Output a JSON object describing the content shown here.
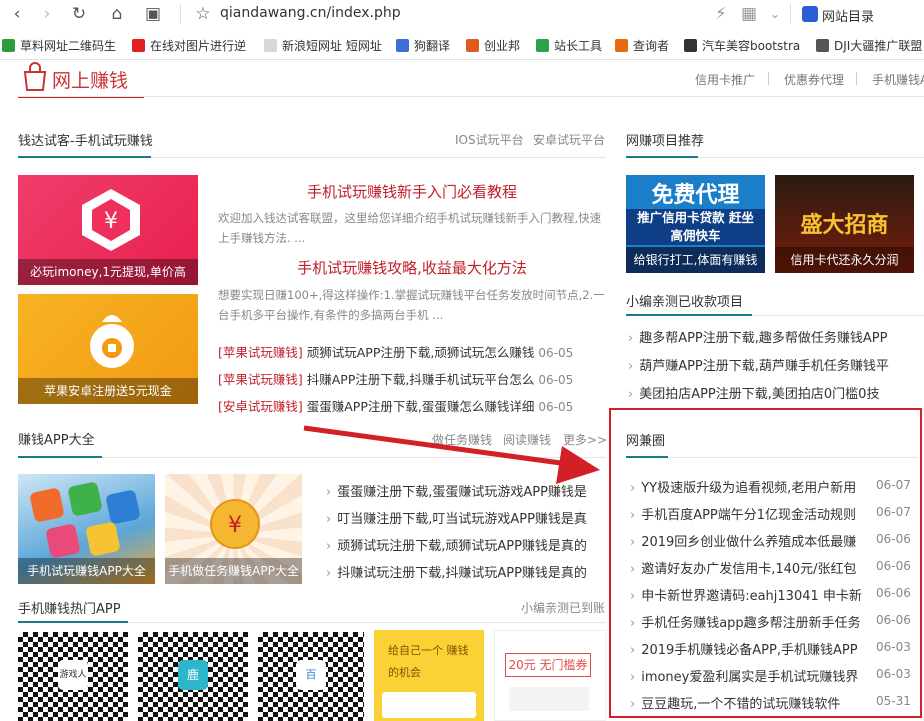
{
  "browser": {
    "url": "qiandawang.cn/index.php",
    "nav_directory": "网站目录",
    "bookmarks": [
      {
        "label": "草料网址二维码生",
        "color": "#2e9a3a"
      },
      {
        "label": "在线对图片进行逆",
        "color": "#e02020"
      },
      {
        "label": "新浪短网址 短网址",
        "color": "#d8d8d8"
      },
      {
        "label": "狗翻译",
        "color": "#3b6fd6"
      },
      {
        "label": "创业邦",
        "color": "#e05a1c"
      },
      {
        "label": "站长工具",
        "color": "#2aa14a"
      },
      {
        "label": "查询者",
        "color": "#e86a10"
      },
      {
        "label": "汽车美容bootstra",
        "color": "#333333"
      },
      {
        "label": "DJI大疆推广联盟",
        "color": "#555555"
      }
    ]
  },
  "header": {
    "logo": "网上赚钱",
    "nav": [
      "信用卡推广",
      "优惠券代理",
      "手机赚钱A"
    ]
  },
  "trial": {
    "title": "钱达试客-手机试玩赚钱",
    "links": [
      "IOS试玩平台",
      "安卓试玩平台"
    ],
    "promo1": "必玩imoney,1元提现,单价高",
    "promo2": "苹果安卓注册送5元现金",
    "article1": {
      "title": "手机试玩赚钱新手入门必看教程",
      "desc": "欢迎加入钱达试客联盟，这里给您详细介绍手机试玩赚钱新手入门教程,快速上手赚钱方法. ..."
    },
    "article2": {
      "title": "手机试玩赚钱攻略,收益最大化方法",
      "desc": "想要实现日赚100+,得这样操作:1.掌握试玩赚钱平台任务发放时间节点,2.一台手机多平台操作,有条件的多搞两台手机 ..."
    },
    "news": [
      {
        "cat": "[苹果试玩赚钱]",
        "text": "顽狮试玩APP注册下载,顽狮试玩怎么赚钱",
        "date": "06-05"
      },
      {
        "cat": "[苹果试玩赚钱]",
        "text": "抖赚APP注册下载,抖赚手机试玩平台怎么",
        "date": "06-05"
      },
      {
        "cat": "[安卓试玩赚钱]",
        "text": "蛋蛋赚APP注册下载,蛋蛋赚怎么赚钱详细",
        "date": "06-05"
      }
    ]
  },
  "apps": {
    "title": "赚钱APP大全",
    "links": [
      "做任务赚钱",
      "阅读赚钱",
      "更多>>"
    ],
    "promo1": "手机试玩赚钱APP大全",
    "promo2": "手机做任务赚钱APP大全",
    "items": [
      "蛋蛋赚注册下载,蛋蛋赚试玩游戏APP赚钱是",
      "叮当赚注册下载,叮当试玩游戏APP赚钱是真",
      "顽狮试玩注册下载,顽狮试玩APP赚钱是真的",
      "抖赚试玩注册下载,抖赚试玩APP赚钱是真的"
    ]
  },
  "hot": {
    "title": "手机赚钱热门APP",
    "link": "小编亲测已到账",
    "qr_labels": [
      "游戏人",
      "鹿",
      "百"
    ],
    "promo_small1": "给自己一个 赚钱的机会",
    "promo_small2": "20元 无门槛券"
  },
  "sidebar": {
    "rec_title": "网赚项目推荐",
    "banner1_big": "免费代理",
    "banner1_mid": "推广信用卡贷款 赶坐高佣快车",
    "banner1_cap": "给银行打工,体面有赚钱",
    "banner2_big": "盛大招商",
    "banner2_cap": "信用卡代还永久分润",
    "tested_title": "小编亲测已收款项目",
    "tested": [
      "趣多帮APP注册下载,趣多帮做任务赚钱APP",
      "葫芦赚APP注册下载,葫芦赚手机任务赚钱平",
      "美团拍店APP注册下载,美团拍店0门槛0技"
    ],
    "wjq_title": "网兼圈",
    "wjq": [
      {
        "text": "YY极速版升级为追看视频,老用户新用",
        "date": "06-07"
      },
      {
        "text": "手机百度APP端午分1亿现金活动规则",
        "date": "06-07"
      },
      {
        "text": "2019回乡创业做什么养殖成本低最赚",
        "date": "06-06"
      },
      {
        "text": "邀请好友办广发信用卡,140元/张红包",
        "date": "06-06"
      },
      {
        "text": "申卡新世界邀请码:eahj13041 申卡新",
        "date": "06-06"
      },
      {
        "text": "手机任务赚钱app趣多帮注册新手任务",
        "date": "06-06"
      },
      {
        "text": "2019手机赚钱必备APP,手机赚钱APP",
        "date": "06-03"
      },
      {
        "text": "imoney爱盈利属实是手机试玩赚钱界",
        "date": "06-03"
      },
      {
        "text": "豆豆趣玩,一个不错的试玩赚钱软件",
        "date": "05-31"
      }
    ]
  }
}
